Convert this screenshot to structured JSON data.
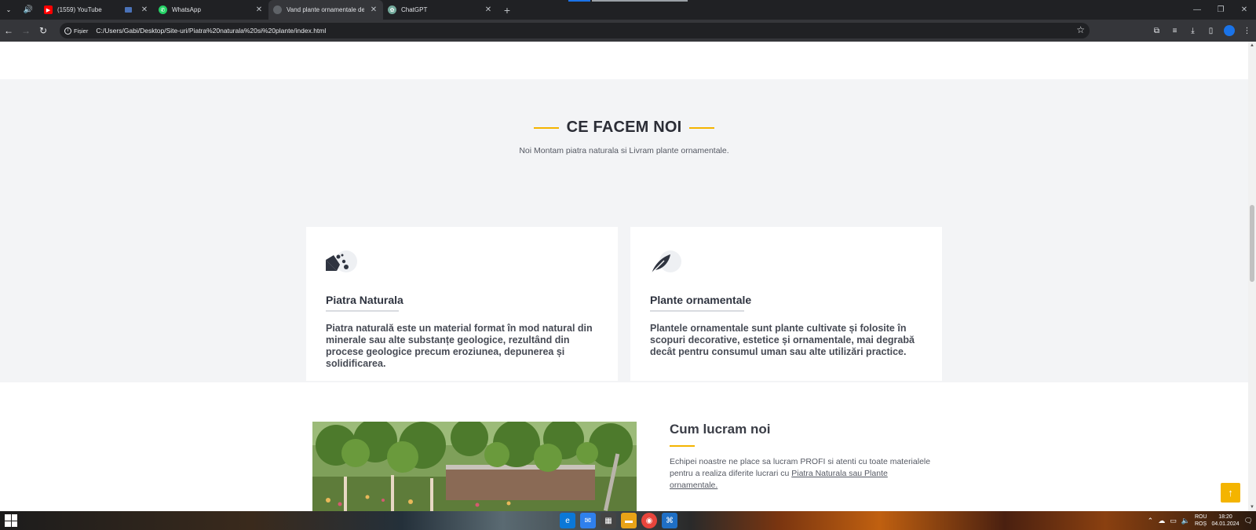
{
  "browser": {
    "tabs": [
      {
        "title": "(1559) YouTube",
        "favicon": "youtube-icon",
        "color": "#ff0000",
        "active": false
      },
      {
        "title": "WhatsApp",
        "favicon": "whatsapp-icon",
        "color": "#25d366",
        "active": false
      },
      {
        "title": "Vand plante ornamentale de to",
        "favicon": "globe-icon",
        "color": "#9aa0a6",
        "active": true
      },
      {
        "title": "ChatGPT",
        "favicon": "chatgpt-icon",
        "color": "#74aa9c",
        "active": false
      }
    ],
    "address": {
      "chip_label": "Fișier",
      "url": "C:/Users/Gabi/Desktop/Site-uri/Piatra%20naturala%20si%20plante/index.html"
    }
  },
  "page": {
    "services": {
      "heading": "CE FACEM NOI",
      "subheading": "Noi Montam piatra naturala si Livram plante ornamentale.",
      "cards": [
        {
          "icon": "stones-icon",
          "title": "Piatra Naturala",
          "text": "Piatra naturală este un material format în mod natural din minerale sau alte substanțe geologice, rezultând din procese geologice precum eroziunea, depunerea și solidificarea."
        },
        {
          "icon": "feather-leaf-icon",
          "title": "Plante ornamentale",
          "text": "Plantele ornamentale sunt plante cultivate și folosite în scopuri decorative, estetice și ornamentale, mai degrabă decât pentru consumul uman sau alte utilizări practice."
        }
      ]
    },
    "how_we_work": {
      "title": "Cum lucram noi",
      "text_before": "Echipei noastre ne place sa lucram PROFI si atenti cu toate materialele pentru a realiza diferite lucrari cu ",
      "link_text": "Piatra Naturala sau Plante ornamentale.",
      "photo": "garden-photo"
    },
    "accent_color": "#f4b400",
    "back_to_top": "↑"
  },
  "taskbar": {
    "lang_top": "ROU",
    "lang_bottom": "ROȘ",
    "time": "18:20",
    "date": "04.01.2024"
  }
}
